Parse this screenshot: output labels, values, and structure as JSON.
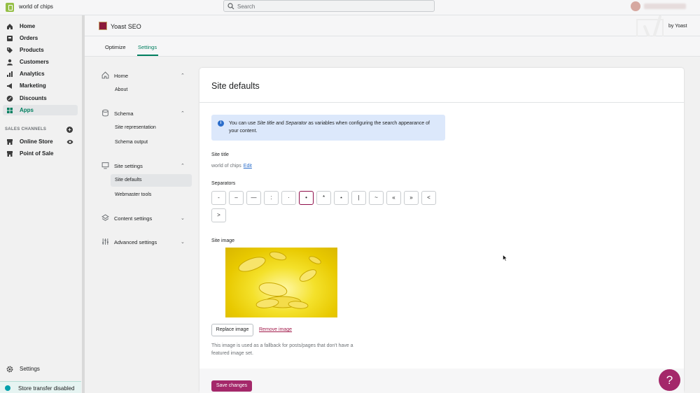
{
  "topbar": {
    "store_name": "world of chips",
    "search_placeholder": "Search"
  },
  "sidebar": {
    "items": [
      {
        "label": "Home",
        "icon": "home-icon"
      },
      {
        "label": "Orders",
        "icon": "orders-icon"
      },
      {
        "label": "Products",
        "icon": "tag-icon"
      },
      {
        "label": "Customers",
        "icon": "person-icon"
      },
      {
        "label": "Analytics",
        "icon": "bar-chart-icon"
      },
      {
        "label": "Marketing",
        "icon": "megaphone-icon"
      },
      {
        "label": "Discounts",
        "icon": "discount-icon"
      },
      {
        "label": "Apps",
        "icon": "apps-icon"
      }
    ],
    "sales_channels_label": "SALES CHANNELS",
    "channels": [
      {
        "label": "Online Store",
        "icon": "store-icon"
      },
      {
        "label": "Point of Sale",
        "icon": "store-icon"
      }
    ],
    "settings_label": "Settings",
    "transfer_label": "Store transfer disabled"
  },
  "app": {
    "title": "Yoast SEO",
    "by": "by Yoast"
  },
  "tabs": [
    {
      "label": "Optimize"
    },
    {
      "label": "Settings"
    }
  ],
  "settings_nav": {
    "home": "Home",
    "about": "About",
    "schema": "Schema",
    "site_representation": "Site representation",
    "schema_output": "Schema output",
    "site_settings": "Site settings",
    "site_defaults": "Site defaults",
    "webmaster_tools": "Webmaster tools",
    "content_settings": "Content settings",
    "advanced_settings": "Advanced settings"
  },
  "main": {
    "title": "Site defaults",
    "info_pre": "You can use ",
    "info_em1": "Site title",
    "info_mid": " and ",
    "info_em2": "Separator",
    "info_post": " as variables when configuring the search appearance of your content.",
    "site_title_label": "Site title",
    "site_title_value": "world of chips",
    "edit_label": "Edit",
    "separators_label": "Separators",
    "separators": [
      "-",
      "–",
      "—",
      ":",
      "·",
      "•",
      "*",
      "⋆",
      "|",
      "~",
      "«",
      "»",
      "<",
      ">"
    ],
    "selected_separator": "•",
    "site_image_label": "Site image",
    "replace_image": "Replace image",
    "remove_image": "Remove image",
    "image_help": "This image is used as a fallback for posts/pages that don't have a featured image set.",
    "save_label": "Save changes"
  },
  "help_button": "?",
  "colors": {
    "accent_green": "#007f5f",
    "yoast_primary": "#a4286a",
    "info_bg": "#dce8fb"
  }
}
